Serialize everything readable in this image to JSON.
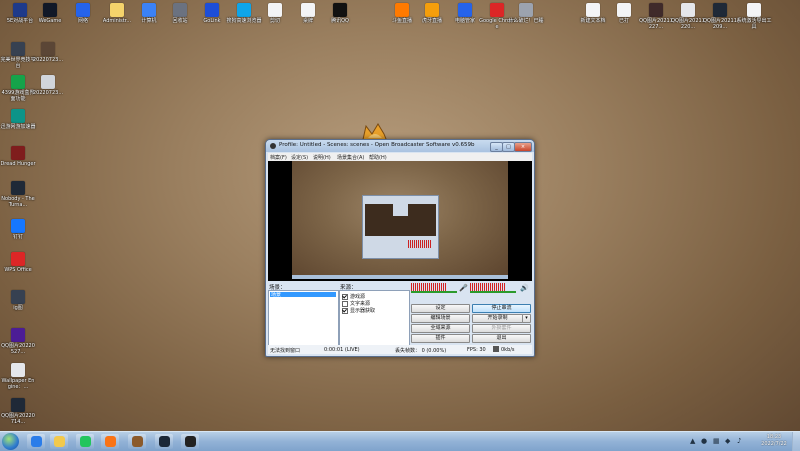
{
  "desktop": {
    "icons_top": [
      {
        "label": "5E对战平台",
        "icon": "5e-icon",
        "color": "#1e3a8a"
      },
      {
        "label": "WeGame",
        "icon": "wegame-icon",
        "color": "#111827"
      },
      {
        "label": "网络",
        "icon": "network-icon",
        "color": "#2563eb"
      },
      {
        "label": "Administr...",
        "icon": "user-folder-icon",
        "color": "#f5d36b"
      },
      {
        "label": "计算机",
        "icon": "computer-icon",
        "color": "#3b82f6"
      },
      {
        "label": "回收站",
        "icon": "recycle-bin-icon",
        "color": "#6b7280"
      },
      {
        "label": "GoLink",
        "icon": "golink-icon",
        "color": "#1d4ed8"
      },
      {
        "label": "搜狗高速浏览器",
        "icon": "sogou-browser-icon",
        "color": "#0ea5e9"
      },
      {
        "label": "剪切",
        "icon": "document-icon",
        "color": "#f3f4f6"
      },
      {
        "label": "桌牌",
        "icon": "document-icon",
        "color": "#f3f4f6"
      },
      {
        "label": "腾讯QQ",
        "icon": "qq-icon",
        "color": "#111111"
      },
      {
        "label": "斗鱼直播",
        "icon": "douyu-icon",
        "color": "#ff7a00"
      },
      {
        "label": "虎牙直播",
        "icon": "huya-icon",
        "color": "#f59e0b"
      },
      {
        "label": "电脑管家",
        "icon": "pc-manager-icon",
        "color": "#2563eb"
      },
      {
        "label": "Google Chrome",
        "icon": "chrome-icon",
        "color": "#dc2626"
      },
      {
        "label": "什么破烂！已睡",
        "icon": "image-icon",
        "color": "#9ca3af"
      },
      {
        "label": "新建文本档",
        "icon": "text-file-icon",
        "color": "#f3f4f6"
      },
      {
        "label": "已打",
        "icon": "text-file-icon",
        "color": "#f3f4f6"
      },
      {
        "label": "QQ图片20211227...",
        "icon": "image-icon",
        "color": "#3f2a2a"
      },
      {
        "label": "QQ图片20211220...",
        "icon": "image-icon",
        "color": "#e5e7eb"
      },
      {
        "label": "QQ图片20211209...",
        "icon": "image-icon",
        "color": "#1f2937"
      },
      {
        "label": "系统激活导出工具",
        "icon": "text-file-icon",
        "color": "#f3f4f6"
      }
    ],
    "icons_left": [
      {
        "label": "完美世界竞技平台",
        "icon": "perfect-world-icon",
        "color": "#374151"
      },
      {
        "label": "20220723...",
        "icon": "image-icon",
        "color": "#5b4636"
      },
      {
        "label": "4399游戏盒界面功能",
        "icon": "4399-icon",
        "color": "#16a34a"
      },
      {
        "label": "20220723...",
        "icon": "image-icon",
        "color": "#d1d5db"
      },
      {
        "label": "迅游网游加速器",
        "icon": "xunyou-icon",
        "color": "#0d9488"
      },
      {
        "label": "Dread Hunger",
        "icon": "dread-hunger-icon",
        "color": "#7f1d1d"
      },
      {
        "label": "Nobody - The Turna...",
        "icon": "nobody-icon",
        "color": "#1f2937"
      },
      {
        "label": "钉钉",
        "icon": "dingtalk-icon",
        "color": "#1677ff"
      },
      {
        "label": "WPS Office",
        "icon": "wps-icon",
        "color": "#dc2626"
      },
      {
        "label": "ig图",
        "icon": "image-icon",
        "color": "#374151"
      },
      {
        "label": "QQ图片20220527...",
        "icon": "image-icon",
        "color": "#4c1d95"
      },
      {
        "label": "Wallpaper Engine：...",
        "icon": "wallpaper-engine-icon",
        "color": "#e5e7eb"
      },
      {
        "label": "QQ图片20220714...",
        "icon": "image-icon",
        "color": "#1f2937"
      }
    ]
  },
  "obs": {
    "title": "Profile: Untitled - Scenes: scenes - Open Broadcaster Software v0.659b",
    "menu": [
      "档案(F)",
      "设定(S)",
      "说明(H)",
      "场景集合(A)",
      "帮助(H)"
    ],
    "scenes_label": "场景：",
    "scene_item": "场景",
    "sources_label": "来源：",
    "sources": [
      {
        "label": "游戏源",
        "checked": true
      },
      {
        "label": "文字来源",
        "checked": false
      },
      {
        "label": "显示器获取",
        "checked": true
      }
    ],
    "buttons": {
      "settings": "设定",
      "stop_stream": "停止串流",
      "edit_scene": "编辑场景",
      "start_record": "开始录制",
      "global_sources": "全域来源",
      "plugins_disabled": "外掛套件",
      "plugins": "插件",
      "exit": "退出"
    },
    "audio": {
      "desktop_level": 0.75,
      "mic_level": 0.78
    },
    "status": {
      "window": "无法找到窗口",
      "time": "0:00:01 (LIVE)",
      "dropped": "丢失帧数： 0 (0.00%)",
      "fps": "FPS: 30",
      "bitrate": "0kb/s"
    }
  },
  "taskbar": {
    "apps": [
      {
        "name": "ie-icon",
        "color": "#2b7de9"
      },
      {
        "name": "qq-browser-icon",
        "color": "#f2c94c"
      },
      {
        "name": "wechat-icon",
        "color": "#22c55e"
      },
      {
        "name": "app-icon",
        "color": "#f97316"
      },
      {
        "name": "game-icon",
        "color": "#8b5a2b"
      },
      {
        "name": "steam-icon",
        "color": "#1b2838"
      },
      {
        "name": "obs-icon",
        "color": "#222222"
      }
    ],
    "clock_time": "18:23",
    "clock_date": "2022/7/22"
  }
}
